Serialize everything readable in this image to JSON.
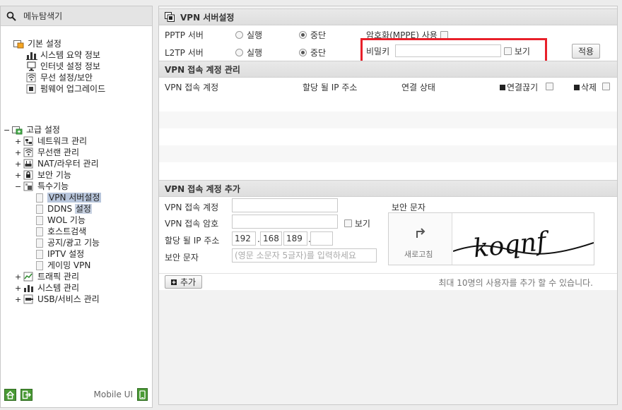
{
  "left_panel": {
    "title": "메뉴탐색기",
    "basic_setup": {
      "label": "기본 설정",
      "items": [
        {
          "label": "시스템 요약 정보"
        },
        {
          "label": "인터넷 설정 정보"
        },
        {
          "label": "무선 설정/보안"
        },
        {
          "label": "펌웨어 업그레이드"
        }
      ]
    },
    "advanced_setup": {
      "label": "고급 설정",
      "items": [
        {
          "label": "네트워크 관리"
        },
        {
          "label": "무선랜 관리"
        },
        {
          "label": "NAT/라우터 관리"
        },
        {
          "label": "보안 기능"
        },
        {
          "label": "특수기능"
        }
      ],
      "special_items": [
        {
          "label": "VPN 서버설정"
        },
        {
          "label_prefix": "DDNS ",
          "label_highlight": "설정"
        },
        {
          "label": "WOL 기능"
        },
        {
          "label": "호스트검색"
        },
        {
          "label": "공지/광고 기능"
        },
        {
          "label": "IPTV 설정"
        },
        {
          "label": "게이밍 VPN"
        }
      ],
      "more_items": [
        {
          "label": "트래픽 관리"
        },
        {
          "label": "시스템 관리"
        },
        {
          "label": "USB/서비스 관리"
        }
      ]
    },
    "expander_plus": "+",
    "expander_minus": "−",
    "mobile_ui": "Mobile UI"
  },
  "vpn_settings": {
    "title": "VPN 서버설정",
    "pptp_label": "PPTP 서버",
    "l2tp_label": "L2TP 서버",
    "run_label": "실행",
    "stop_label": "중단",
    "mppe_label": "암호화(MPPE) 사용",
    "secret_label": "비밀키",
    "secret_value": "",
    "show_label": "보기",
    "apply_label": "적용"
  },
  "account_mgmt": {
    "title": "VPN 접속 계정 관리",
    "columns": {
      "account": "VPN 접속 계정",
      "ip": "할당 될 IP 주소",
      "status": "연결 상태",
      "disconnect": "연결끊기",
      "delete": "삭제"
    }
  },
  "account_add": {
    "title": "VPN 접속 계정 추가",
    "account_label": "VPN 접속 계정",
    "password_label": "VPN 접속 암호",
    "show_label": "보기",
    "ip_label": "할당 될 IP 주소",
    "ip_octets": [
      "192",
      "168",
      "189",
      ""
    ],
    "security_label": "보안 문자",
    "security_placeholder": "(영문 소문자 5글자)를 입력하세요",
    "captcha_title": "보안 문자",
    "refresh_label": "새로고침",
    "captcha_text": "koqnf",
    "add_label": "추가",
    "max_note": "최대 10명의 사용자를 추가 할 수 있습니다."
  }
}
